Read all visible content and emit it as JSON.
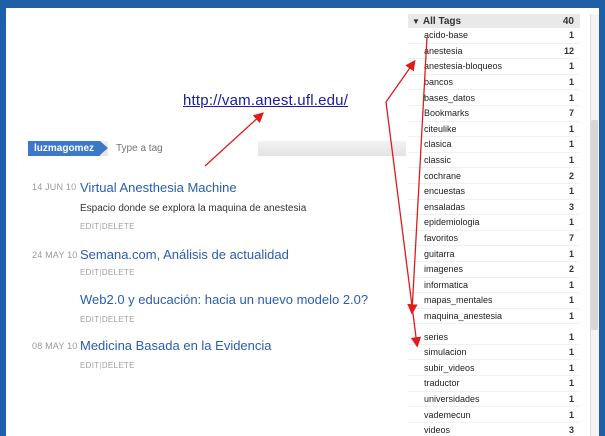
{
  "annotation": {
    "url": "http://vam.anest.ufl.edu/"
  },
  "tagbar": {
    "user": "luzmagomez",
    "placeholder": "Type a tag"
  },
  "actions": {
    "edit": "EDIT",
    "sep": "|",
    "delete": "DELETE"
  },
  "bookmarks": [
    {
      "date": "14 JUN 10",
      "title": "Virtual Anesthesia Machine",
      "description": "Espacio donde se explora la maquina de anestesia"
    },
    {
      "date": "24 MAY 10",
      "title": "Semana.com, Análisis de actualidad",
      "description": ""
    },
    {
      "date": "",
      "title": "Web2.0 y educación: hacia un nuevo modelo 2.0?",
      "description": ""
    },
    {
      "date": "08 MAY 10",
      "title": "Medicina Basada en la Evidencia",
      "description": ""
    }
  ],
  "tags_panel": {
    "header": "All Tags",
    "total": "40",
    "tags": [
      {
        "name": "acido-base",
        "count": "1"
      },
      {
        "name": "anestesia",
        "count": "12"
      },
      {
        "name": "anestesia-bloqueos",
        "count": "1"
      },
      {
        "name": "bancos",
        "count": "1"
      },
      {
        "name": "bases_datos",
        "count": "1"
      },
      {
        "name": "Bookmarks",
        "count": "7"
      },
      {
        "name": "citeulike",
        "count": "1"
      },
      {
        "name": "clasica",
        "count": "1"
      },
      {
        "name": "classic",
        "count": "1"
      },
      {
        "name": "cochrane",
        "count": "2"
      },
      {
        "name": "encuestas",
        "count": "1"
      },
      {
        "name": "ensaladas",
        "count": "3"
      },
      {
        "name": "epidemiologia",
        "count": "1"
      },
      {
        "name": "favoritos",
        "count": "7"
      },
      {
        "name": "guitarra",
        "count": "1"
      },
      {
        "name": "imagenes",
        "count": "2"
      },
      {
        "name": "informatica",
        "count": "1"
      },
      {
        "name": "mapas_mentales",
        "count": "1"
      },
      {
        "name": "maquina_anestesia",
        "count": "1"
      }
    ],
    "tags_after": [
      {
        "name": "series",
        "count": "1"
      },
      {
        "name": "simulacion",
        "count": "1"
      },
      {
        "name": "subir_videos",
        "count": "1"
      },
      {
        "name": "traductor",
        "count": "1"
      },
      {
        "name": "universidades",
        "count": "1"
      },
      {
        "name": "vademecun",
        "count": "1"
      },
      {
        "name": "videos",
        "count": "3"
      }
    ]
  },
  "colors": {
    "frame": "#1f5fa8",
    "link": "#2a5db0",
    "arrow": "#e01b1b",
    "user_badge": "#3d78c8"
  },
  "icons": {
    "collapse": "triangle-down-icon",
    "arrow": "red-arrow-icon"
  }
}
